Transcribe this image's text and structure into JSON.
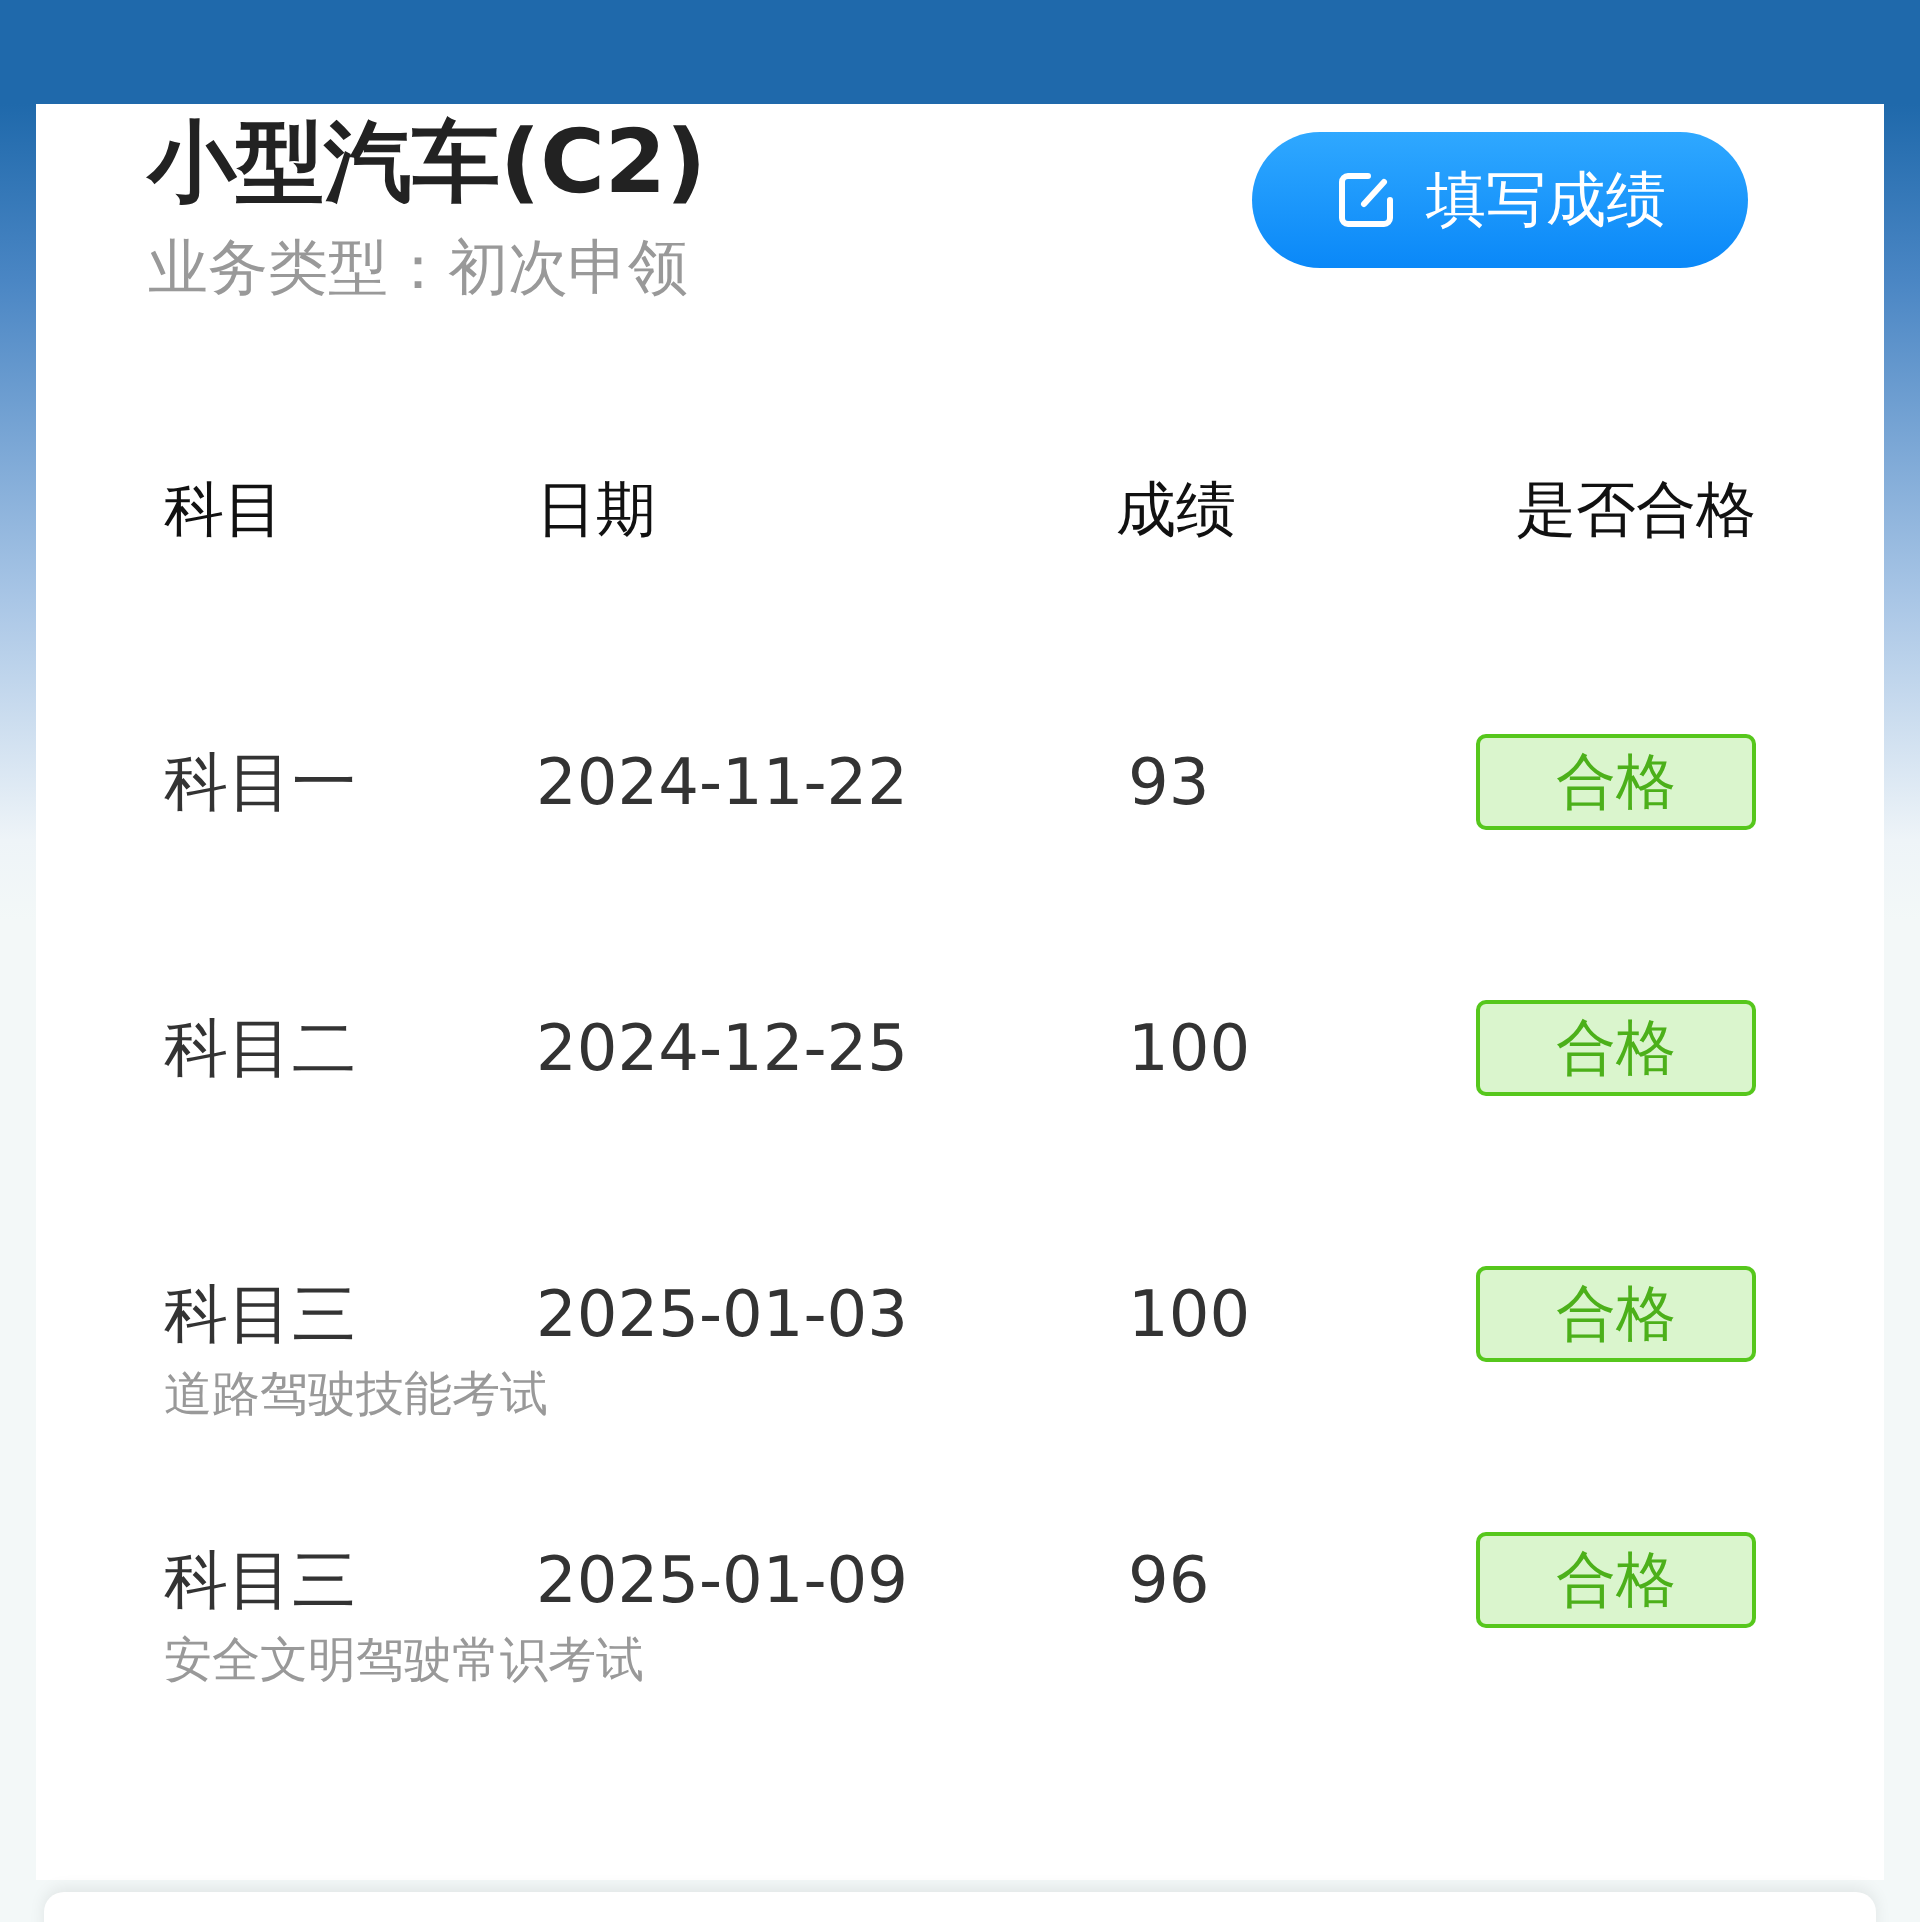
{
  "license": {
    "title": "小型汽车(C2)",
    "business_type": "业务类型：初次申领"
  },
  "fill_button": {
    "label": "填写成绩"
  },
  "table": {
    "columns": [
      "科目",
      "日期",
      "成绩",
      "是否合格"
    ],
    "rows": [
      {
        "subject": "科目一",
        "date": "2024-11-22",
        "score": "93",
        "result": "合格",
        "passed": true
      },
      {
        "subject": "科目二",
        "date": "2024-12-25",
        "score": "100",
        "result": "合格",
        "passed": true
      },
      {
        "subject": "科目三",
        "note": "道路驾驶技能考试",
        "date": "2025-01-03",
        "score": "100",
        "result": "合格",
        "passed": true
      },
      {
        "subject": "科目三",
        "note": "安全文明驾驶常识考试",
        "date": "2025-01-09",
        "score": "96",
        "result": "合格",
        "passed": true
      }
    ]
  }
}
